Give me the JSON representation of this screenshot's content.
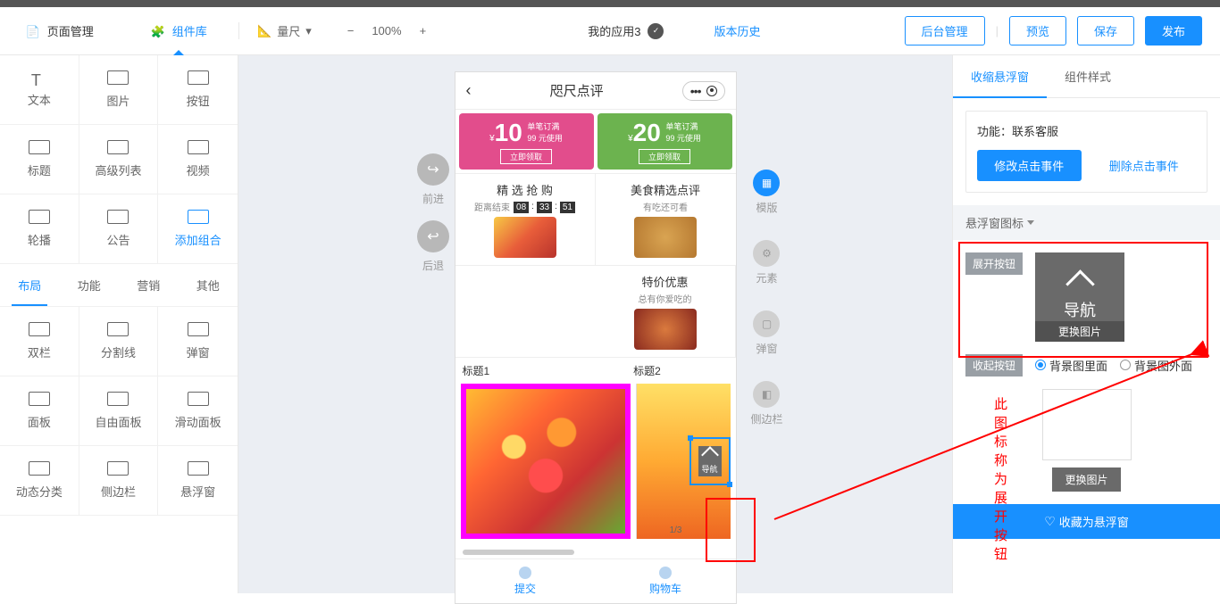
{
  "header": {
    "page_mgmt": "页面管理",
    "comp_lib": "组件库",
    "ruler": "量尺",
    "zoom_minus": "−",
    "zoom_pct": "100%",
    "zoom_plus": "+",
    "app_name": "我的应用3",
    "version": "版本历史",
    "backstage": "后台管理",
    "preview": "预览",
    "save": "保存",
    "publish": "发布"
  },
  "components": {
    "row1": [
      "文本",
      "图片",
      "按钮"
    ],
    "row2": [
      "标题",
      "高级列表",
      "视频"
    ],
    "row3": [
      "轮播",
      "公告",
      "添加组合"
    ],
    "tabs": [
      "布局",
      "功能",
      "营销",
      "其他"
    ],
    "row4": [
      "双栏",
      "分割线",
      "弹窗"
    ],
    "row5": [
      "面板",
      "自由面板",
      "滑动面板"
    ],
    "row6": [
      "动态分类",
      "侧边栏",
      "悬浮窗"
    ]
  },
  "tools": {
    "forward": "前进",
    "back": "后退"
  },
  "phone": {
    "title": "咫尺点评",
    "coupon1": {
      "num": "10",
      "line1": "单笔订满",
      "line2": "99 元使用",
      "btn": "立即领取"
    },
    "coupon2": {
      "num": "20",
      "line1": "单笔订满",
      "line2": "99 元使用",
      "btn": "立即领取"
    },
    "food": {
      "c1t": "精 选 抢 购",
      "c1s": "距离结束",
      "cd": [
        "08",
        "33",
        "51"
      ],
      "c2t": "美食精选点评",
      "c2s": "有吃还可看",
      "c3t": "特价优惠",
      "c3s": "总有你爱吃的"
    },
    "title1": "标题1",
    "title2": "标题2",
    "pager": "1/3",
    "float_label": "导航",
    "tab1": "提交",
    "tab2": "购物车"
  },
  "side": {
    "template": "模版",
    "element": "元素",
    "popup": "弹窗",
    "sidebar": "侧边栏"
  },
  "annotation": "此图标称为展开按钮",
  "right": {
    "tab1": "收缩悬浮窗",
    "tab2": "组件样式",
    "fn_label": "功能：联系客服",
    "btn_modify": "修改点击事件",
    "btn_delete": "删除点击事件",
    "section": "悬浮窗图标",
    "expand_badge": "展开按钮",
    "nav": "导航",
    "change_img": "更换图片",
    "collapse_badge": "收起按钮",
    "radio1": "背景图里面",
    "radio2": "背景图外面",
    "change_img2": "更换图片",
    "favorite": "收藏为悬浮窗"
  }
}
